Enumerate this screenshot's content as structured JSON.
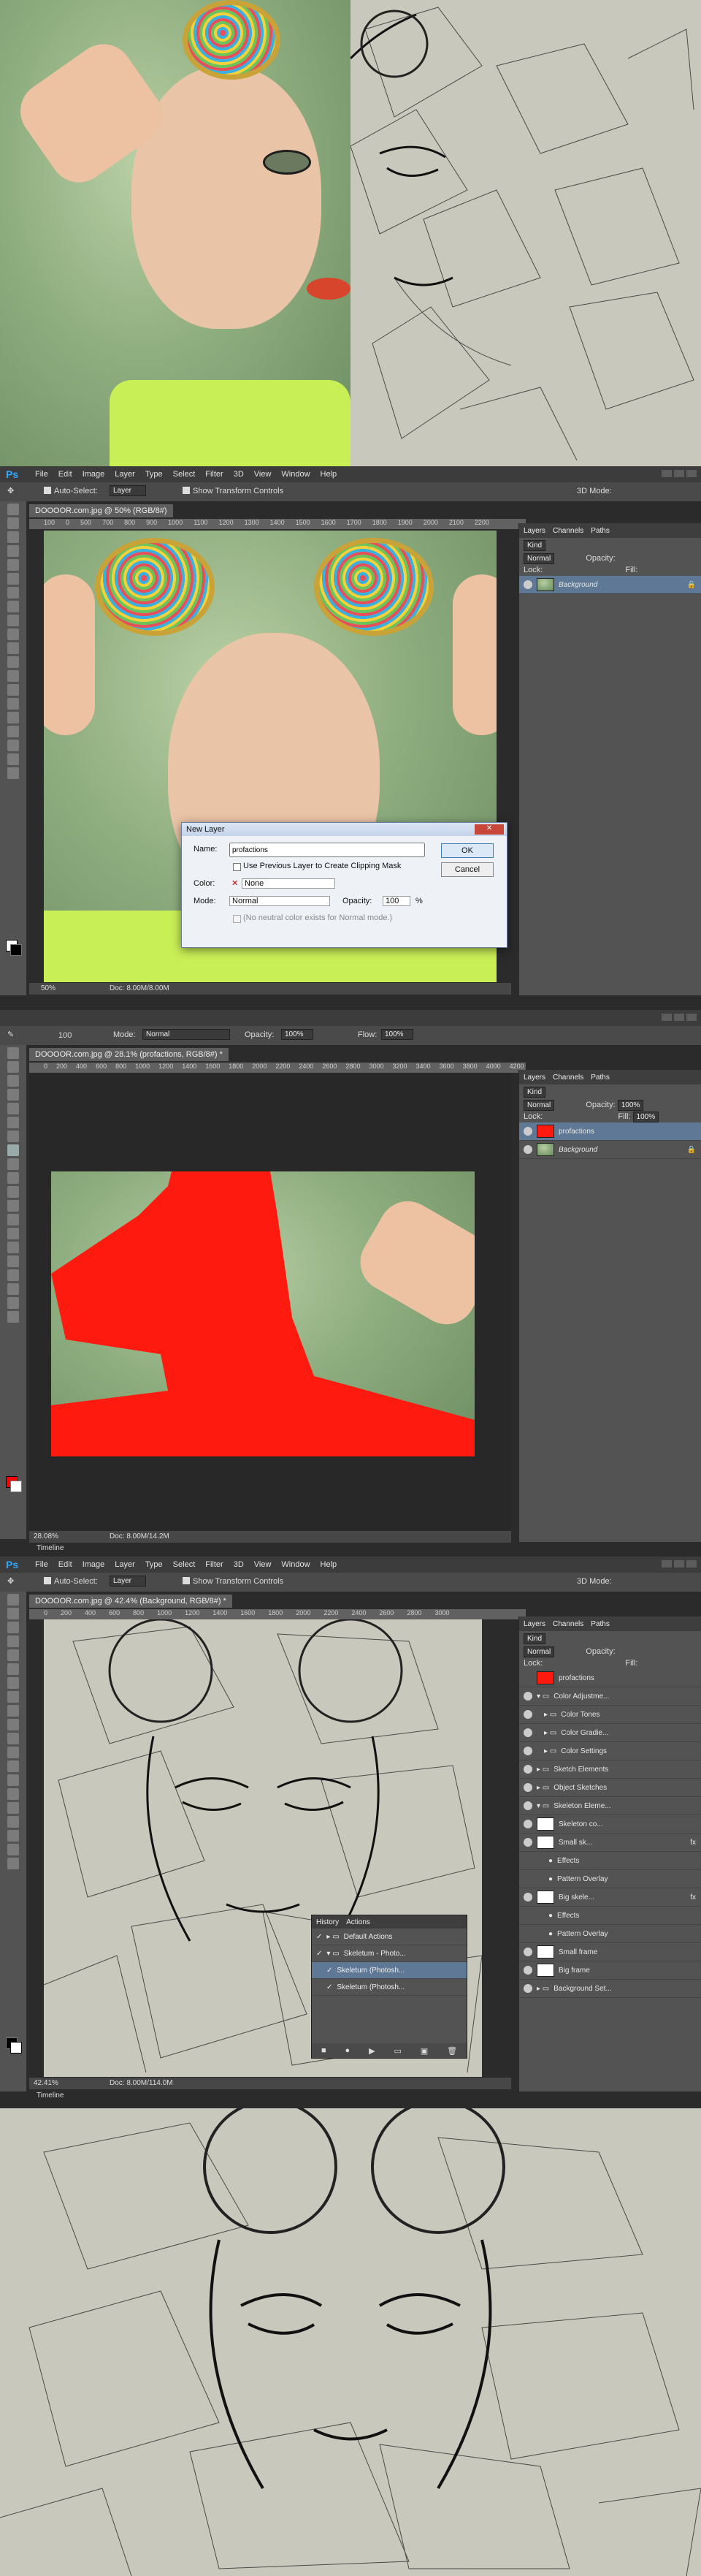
{
  "colors": {
    "ps_blue": "#30a8ff",
    "selected_layer": "#5f7895",
    "red_mask": "#ff1a10",
    "layer_marker": "#b49a2a"
  },
  "panel1": {
    "description_hidden": ""
  },
  "app": {
    "logo": "Ps",
    "menu": [
      "File",
      "Edit",
      "Image",
      "Layer",
      "Type",
      "Select",
      "Filter",
      "3D",
      "View",
      "Window",
      "Help"
    ]
  },
  "screen1": {
    "options": {
      "auto_select": "Auto-Select:",
      "auto_select_value": "Layer",
      "transform": "Show Transform Controls",
      "mode_3d": "3D Mode:"
    },
    "doc_tab": "DOOOOR.com.jpg @ 50% (RGB/8#)",
    "ruler_ticks": [
      "100",
      "0",
      "500",
      "700",
      "800",
      "900",
      "1000",
      "1100",
      "1200",
      "1300",
      "1400",
      "1500",
      "1600",
      "1700",
      "1800",
      "1900",
      "2000",
      "2100",
      "2200"
    ],
    "panel_tabs": [
      "Layers",
      "Channels",
      "Paths"
    ],
    "kind": "Kind",
    "blend": "Normal",
    "opacity_label": "Opacity:",
    "lock_label": "Lock:",
    "fill_label": "Fill:",
    "layers": [
      {
        "name": "Background"
      }
    ],
    "status": {
      "zoom": "50%",
      "doc": "Doc: 8.00M/8.00M"
    },
    "dialog": {
      "title": "New Layer",
      "name_label": "Name:",
      "name_value": "profactions",
      "clip_label": "Use Previous Layer to Create Clipping Mask",
      "color_label": "Color:",
      "color_value": "None",
      "mode_label": "Mode:",
      "mode_value": "Normal",
      "opacity_label": "Opacity:",
      "opacity_value": "100",
      "percent": "%",
      "neutral_label": "(No neutral color exists for Normal mode.)",
      "ok": "OK",
      "cancel": "Cancel"
    }
  },
  "screen2": {
    "options": {
      "mode_label": "Mode:",
      "mode_value": "Normal",
      "opacity_label": "Opacity:",
      "opacity_value": "100%",
      "flow_label": "Flow:",
      "flow_value": "100%",
      "brush_size": "100"
    },
    "doc_tab": "DOOOOR.com.jpg @ 28.1% (profactions, RGB/8#) *",
    "ruler_ticks": [
      "0",
      "200",
      "400",
      "600",
      "800",
      "1000",
      "1200",
      "1400",
      "1600",
      "1800",
      "2000",
      "2200",
      "2400",
      "2600",
      "2800",
      "3000",
      "3200",
      "3400",
      "3600",
      "3800",
      "4000",
      "4200",
      "4400",
      "4600",
      "4800",
      "5000",
      "5200"
    ],
    "panel_tabs": [
      "Layers",
      "Channels",
      "Paths"
    ],
    "kind": "Kind",
    "blend": "Normal",
    "opacity_label": "Opacity:",
    "opacity_value": "100%",
    "lock_label": "Lock:",
    "fill_label": "Fill:",
    "fill_value": "100%",
    "layers": [
      {
        "name": "profactions"
      },
      {
        "name": "Background"
      }
    ],
    "status": {
      "zoom": "28.08%",
      "doc": "Doc: 8.00M/14.2M"
    },
    "timeline": "Timeline"
  },
  "screen3": {
    "options": {
      "auto_select": "Auto-Select:",
      "auto_select_value": "Layer",
      "transform": "Show Transform Controls",
      "mode_3d": "3D Mode:"
    },
    "doc_tab": "DOOOOR.com.jpg @ 42.4% (Background, RGB/8#) *",
    "ruler_ticks": [
      "0",
      "200",
      "400",
      "600",
      "800",
      "1000",
      "1200",
      "1400",
      "1600",
      "1800",
      "2000",
      "2200",
      "2400",
      "2600",
      "2800",
      "3000"
    ],
    "panel_tabs": [
      "Layers",
      "Channels",
      "Paths"
    ],
    "kind": "Kind",
    "blend": "Normal",
    "opacity_label": "Opacity:",
    "lock_label": "Lock:",
    "fill_label": "Fill:",
    "layers": [
      {
        "name": "profactions"
      },
      {
        "name": "Color Adjustme..."
      },
      {
        "name": "Color Tones"
      },
      {
        "name": "Color Gradie..."
      },
      {
        "name": "Color Settings"
      },
      {
        "name": "Sketch Elements"
      },
      {
        "name": "Object Sketches"
      },
      {
        "name": "Skeleton Eleme..."
      },
      {
        "name": "Skeleton co..."
      },
      {
        "name": "Small sk..."
      },
      {
        "name": "Effects"
      },
      {
        "name": "Pattern Overlay"
      },
      {
        "name": "Big skele..."
      },
      {
        "name": "Effects"
      },
      {
        "name": "Pattern Overlay"
      },
      {
        "name": "Small frame"
      },
      {
        "name": "Big frame"
      },
      {
        "name": "Background Set..."
      }
    ],
    "actions": {
      "tabs": [
        "History",
        "Actions"
      ],
      "rows": [
        "Default Actions",
        "Skeletum - Photo...",
        "Skeletum (Photosh...",
        "Skeletum (Photosh..."
      ]
    },
    "status": {
      "zoom": "42.41%",
      "doc": "Doc: 8.00M/114.0M"
    },
    "timeline": "Timeline"
  }
}
